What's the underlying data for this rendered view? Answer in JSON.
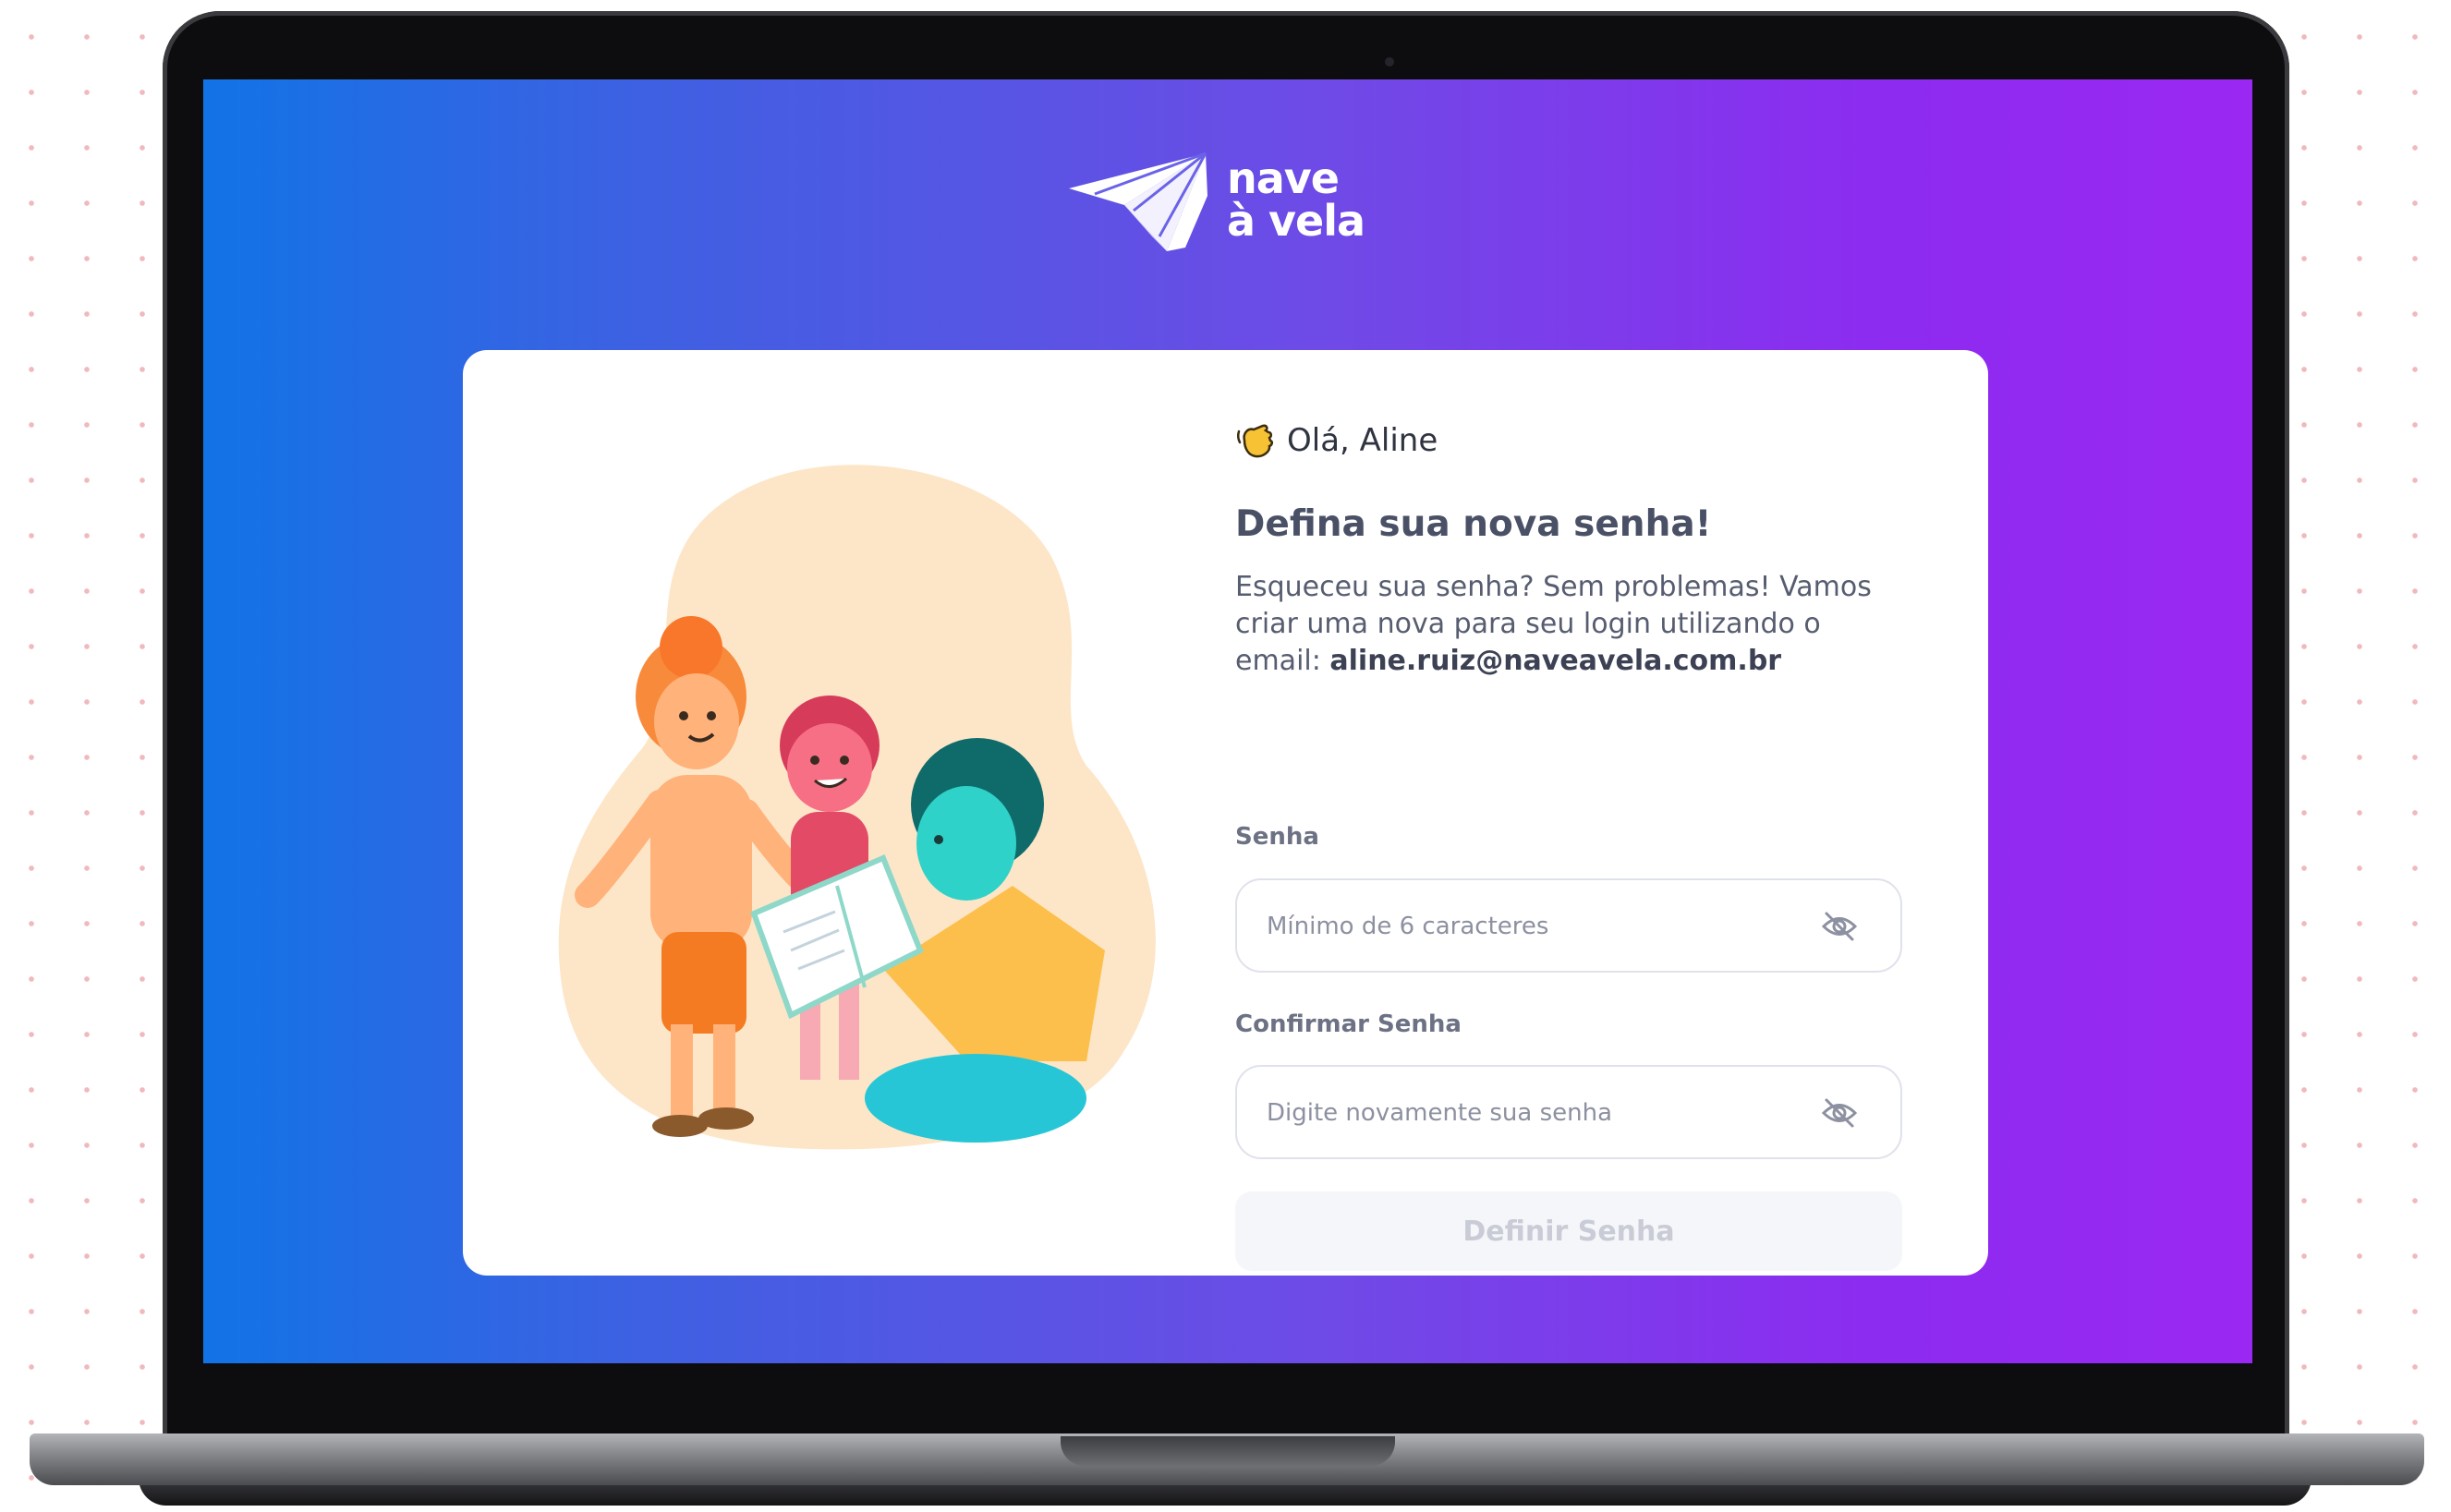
{
  "brand": {
    "name_line1": "nave",
    "name_line2": "à vela"
  },
  "form": {
    "greeting": "Olá, Aline",
    "heading": "Defina sua nova senha!",
    "description": "Esqueceu sua senha? Sem problemas! Vamos criar uma nova para seu login utilizando o email:",
    "email": "aline.ruiz@naveavela.com.br",
    "password_label": "Senha",
    "password_placeholder": "Mínimo de 6 caracteres",
    "password_value": "",
    "confirm_label": "Confirmar Senha",
    "confirm_placeholder": "Digite novamente sua senha",
    "confirm_value": "",
    "submit_label": "Definir Senha"
  },
  "icons": {
    "greeting": "waving-hand-icon",
    "password_toggle": "eye-slash-icon",
    "confirm_toggle": "eye-slash-icon"
  },
  "colors": {
    "gradient_start": "#1273e6",
    "gradient_end": "#9a28f2",
    "heading_text": "#4a5166",
    "button_disabled_bg": "#f5f6f9",
    "button_disabled_text": "#c9ccd6"
  }
}
